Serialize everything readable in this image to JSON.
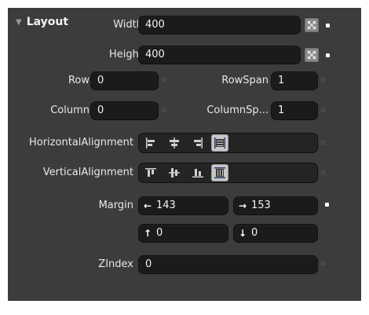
{
  "section": {
    "title": "Layout"
  },
  "width": {
    "label": "Width",
    "value": "400"
  },
  "height": {
    "label": "Height",
    "value": "400"
  },
  "row": {
    "label": "Row",
    "value": "0"
  },
  "rowspan": {
    "label": "RowSpan",
    "value": "1"
  },
  "column": {
    "label": "Column",
    "value": "0"
  },
  "columnspan": {
    "label": "ColumnSp...",
    "value": "1"
  },
  "halign": {
    "label": "HorizontalAlignment",
    "selected": "stretch"
  },
  "valign": {
    "label": "VerticalAlignment",
    "selected": "stretch"
  },
  "margin": {
    "label": "Margin",
    "left": "143",
    "right": "153",
    "top": "0",
    "bottom": "0"
  },
  "zindex": {
    "label": "ZIndex",
    "value": "0"
  }
}
